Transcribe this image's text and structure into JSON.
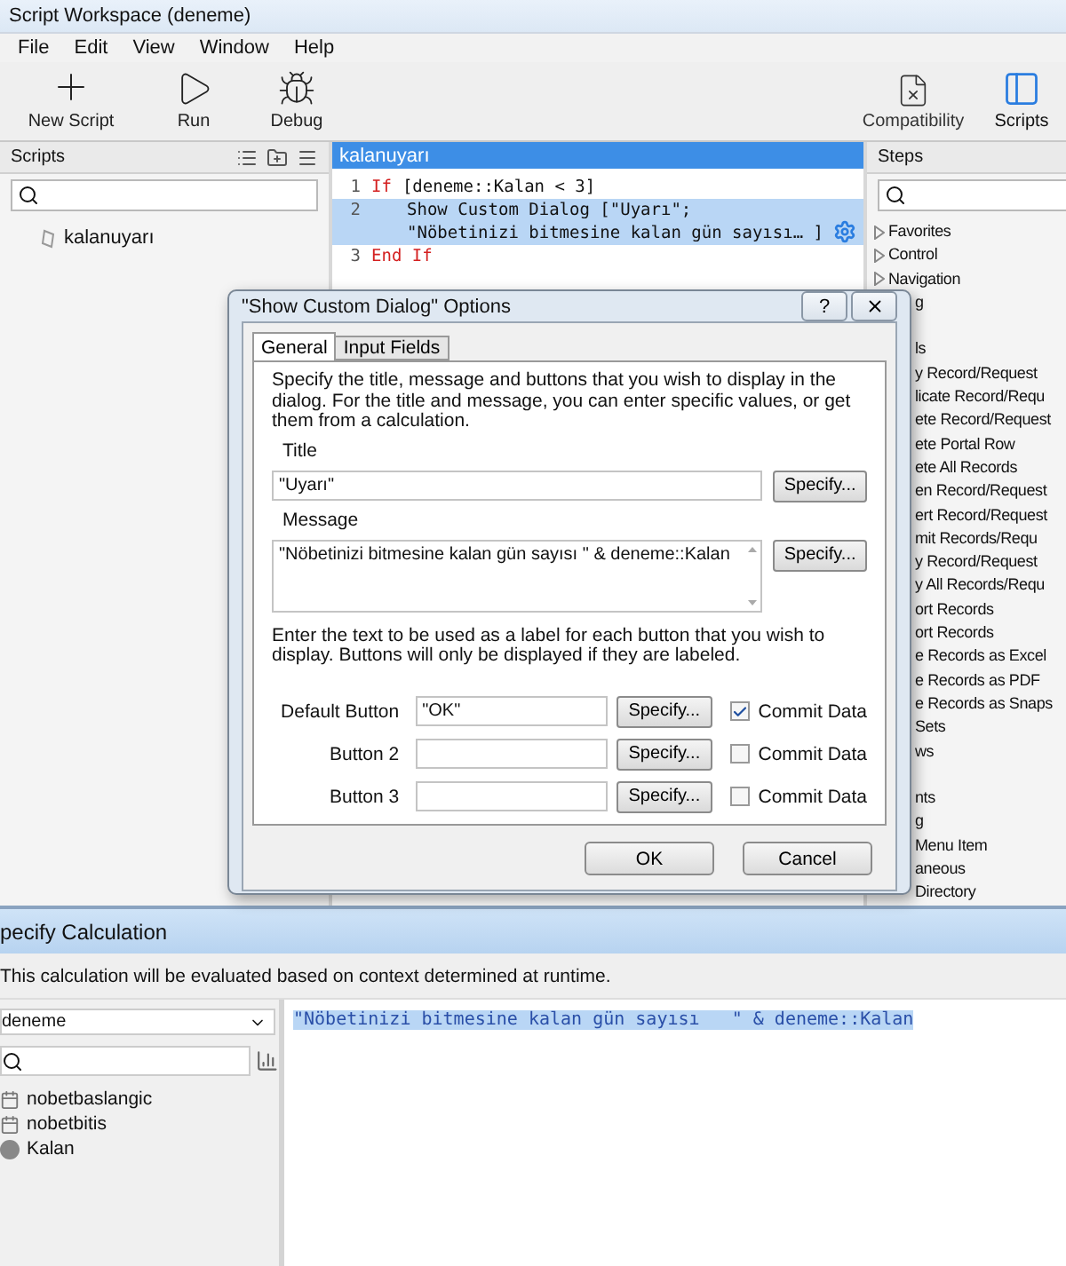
{
  "window": {
    "title": "Script Workspace (deneme)"
  },
  "menu": [
    "File",
    "Edit",
    "View",
    "Window",
    "Help"
  ],
  "toolbar": {
    "left": [
      {
        "kind": "new",
        "label": "New Script"
      },
      {
        "kind": "run",
        "label": "Run"
      },
      {
        "kind": "debug",
        "label": "Debug"
      }
    ],
    "right": [
      {
        "kind": "compat",
        "label": "Compatibility",
        "selected": false
      },
      {
        "kind": "scripts",
        "label": "Scripts",
        "selected": true
      }
    ]
  },
  "scripts_panel": {
    "title": "Scripts",
    "items": [
      "kalanuyarı"
    ]
  },
  "editor": {
    "tab": "kalanuyarı",
    "lines": [
      {
        "number": "1",
        "keyword": "If",
        "text": "[deneme::Kalan < 3]",
        "selected": false
      },
      {
        "number": "2",
        "text": "Show Custom Dialog [\"Uyarı\";",
        "continuation": "\"Nöbetinizi bitmesine kalan gün sayısı… ]",
        "selected": true
      },
      {
        "number": "3",
        "keyword": "End If",
        "selected": false
      }
    ]
  },
  "steps_panel": {
    "title": "Steps",
    "items": [
      {
        "kind": "category",
        "label": "Favorites"
      },
      {
        "kind": "category",
        "label": "Control"
      },
      {
        "kind": "category",
        "label": "Navigation"
      },
      {
        "kind": "clipped",
        "label": "g"
      },
      {
        "kind": "gap"
      },
      {
        "kind": "clipped",
        "label": "ls"
      },
      {
        "kind": "clipped",
        "label": "y Record/Request"
      },
      {
        "kind": "clipped",
        "label": "licate Record/Requ"
      },
      {
        "kind": "clipped",
        "label": "ete Record/Request"
      },
      {
        "kind": "clipped",
        "label": "ete Portal Row"
      },
      {
        "kind": "clipped",
        "label": "ete All Records"
      },
      {
        "kind": "clipped",
        "label": "en Record/Request"
      },
      {
        "kind": "clipped",
        "label": "ert Record/Request"
      },
      {
        "kind": "clipped",
        "label": "mit Records/Requ"
      },
      {
        "kind": "clipped",
        "label": "y Record/Request"
      },
      {
        "kind": "clipped",
        "label": "y All Records/Requ"
      },
      {
        "kind": "clipped",
        "label": "ort Records"
      },
      {
        "kind": "clipped",
        "label": "ort Records"
      },
      {
        "kind": "clipped",
        "label": "e Records as Excel"
      },
      {
        "kind": "clipped",
        "label": "e Records as PDF"
      },
      {
        "kind": "clipped",
        "label": "e Records as Snaps"
      },
      {
        "kind": "clipped",
        "label": "Sets"
      },
      {
        "kind": "clipped",
        "label": "ws"
      },
      {
        "kind": "gap"
      },
      {
        "kind": "clipped",
        "label": "nts"
      },
      {
        "kind": "clipped",
        "label": "g"
      },
      {
        "kind": "clipped",
        "label": "Menu Item"
      },
      {
        "kind": "clipped",
        "label": "aneous"
      },
      {
        "kind": "clipped",
        "label": "Directory"
      }
    ]
  },
  "dialog": {
    "title": "\"Show Custom Dialog\" Options",
    "help": "?",
    "tabs": [
      {
        "label": "General",
        "selected": true
      },
      {
        "label": "Input Fields",
        "selected": false
      }
    ],
    "intro": "Specify the title, message and buttons that you wish to display in the dialog.  For the title and message, you can enter specific values, or get them from a calculation.",
    "title_label": "Title",
    "title_value": "\"Uyarı\"",
    "title_specify": "Specify...",
    "message_label": "Message",
    "message_value": "\"Nöbetinizi bitmesine kalan gün sayısı   \" & deneme::Kalan",
    "message_specify": "Specify...",
    "buttons_intro": "Enter the text to be used as a label for each button that you wish to display. Buttons will only be displayed if they are labeled.",
    "button_rows": [
      {
        "label": "Default Button",
        "value": "\"OK\"",
        "specify": "Specify...",
        "commit": "Commit Data",
        "checked": true
      },
      {
        "label": "Button 2",
        "specify": "Specify...",
        "commit": "Commit Data",
        "checked": false
      },
      {
        "label": "Button 3",
        "specify": "Specify...",
        "commit": "Commit Data",
        "checked": false
      }
    ],
    "ok": "OK",
    "cancel": "Cancel"
  },
  "calculation": {
    "title": "pecify Calculation",
    "info": "This calculation will be evaluated based on context determined at runtime.",
    "table": "deneme",
    "fields": [
      {
        "kind": "date",
        "name": "nobetbaslangic"
      },
      {
        "kind": "date",
        "name": "nobetbitis"
      },
      {
        "kind": "calc",
        "name": "Kalan"
      }
    ],
    "formula": "\"Nöbetinizi bitmesine kalan gün sayısı   \" & deneme::Kalan"
  }
}
